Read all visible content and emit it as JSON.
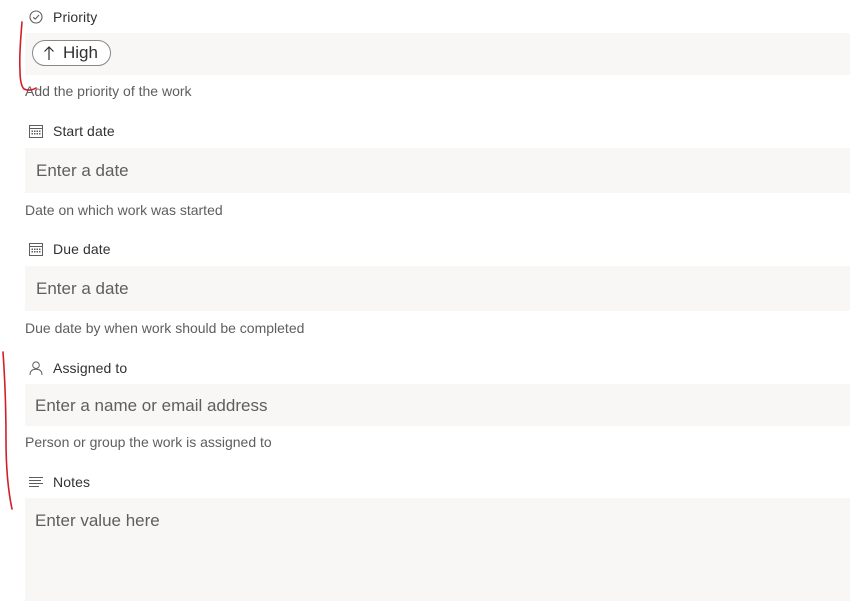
{
  "priority": {
    "label": "Priority",
    "icon": "check-circle-icon",
    "value": "High",
    "value_icon": "arrow-up-icon",
    "help": "Add the priority of the work"
  },
  "start_date": {
    "label": "Start date",
    "icon": "calendar-icon",
    "placeholder": "Enter a date",
    "help": "Date on which work was started"
  },
  "due_date": {
    "label": "Due date",
    "icon": "calendar-icon",
    "placeholder": "Enter a date",
    "help": "Due date by when work should be completed"
  },
  "assigned_to": {
    "label": "Assigned to",
    "icon": "person-icon",
    "placeholder": "Enter a name or email address",
    "help": "Person or group the work is assigned to"
  },
  "notes": {
    "label": "Notes",
    "icon": "text-lines-icon",
    "placeholder": "Enter value here"
  },
  "colors": {
    "input_bg": "#f8f7f6",
    "annotation": "#d11f2a"
  }
}
